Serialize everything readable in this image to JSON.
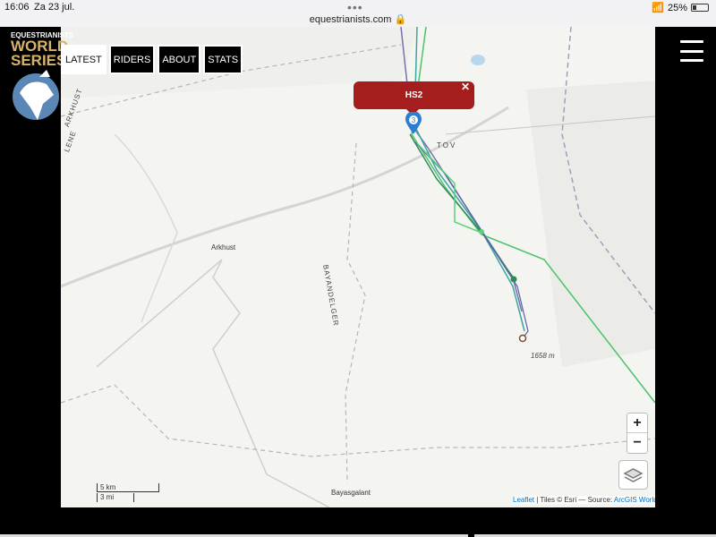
{
  "statusbar": {
    "time": "16:06",
    "date": "Za 23 jul.",
    "url": "equestrianists.com",
    "battery": "25%"
  },
  "logo": {
    "line1": "EQUESTRIANISTS",
    "line2": "WORLD",
    "line3": "SERIES"
  },
  "nav": {
    "tabs": [
      {
        "label": "LATEST",
        "active": true
      },
      {
        "label": "RIDERS",
        "active": false
      },
      {
        "label": "ABOUT",
        "active": false
      },
      {
        "label": "STATS",
        "active": false
      }
    ]
  },
  "map": {
    "popup_title": "HS2",
    "popup_close": "✕",
    "marker_number": "3",
    "labels": {
      "arkhust": "Arkhust",
      "bayandelger": "BAYANDELGER",
      "tov": "TOV",
      "bayasgalant": "Bayasgalant",
      "arkhust_region": "ARKHUST",
      "elevation": "1658 m",
      "top_region": "LENE"
    },
    "zoom_in": "+",
    "zoom_out": "−",
    "scale_km": "5 km",
    "scale_mi": "3 mi",
    "attribution": {
      "leaflet": "Leaflet",
      "tiles": " | Tiles © Esri — Source: ",
      "source_link": "ArcGIS World Topographic Map"
    }
  },
  "colors": {
    "popup": "#a51d1d",
    "marker": "#2a7fd4",
    "track_green": "#4cc26b",
    "track_purple": "#7a6fb0",
    "track_teal": "#3aa6a0"
  }
}
